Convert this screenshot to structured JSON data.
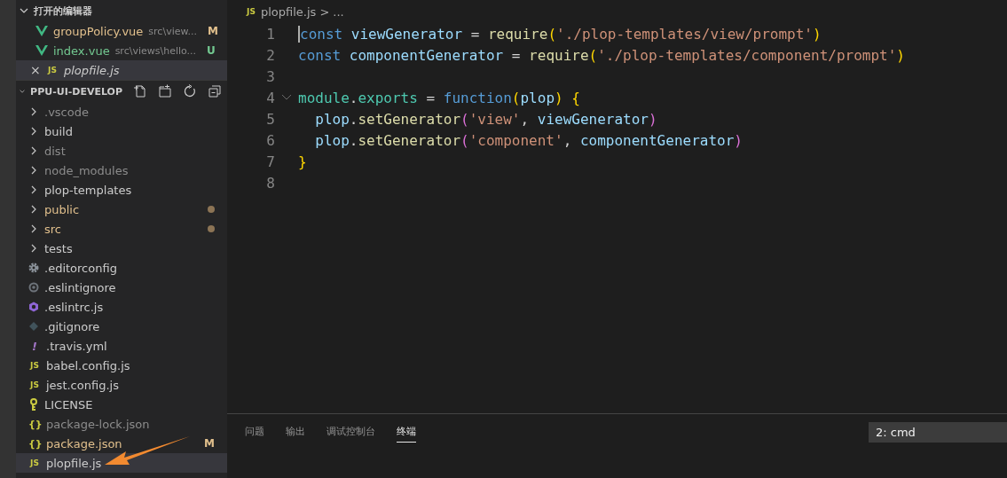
{
  "open_editors": {
    "title": "打开的编辑器",
    "expanded": true,
    "items": [
      {
        "kind": "vue",
        "name": "groupPolicy.vue",
        "path": "src\\view...",
        "color": "#e2c08d",
        "badge": "M",
        "selected": false
      },
      {
        "kind": "vue",
        "name": "index.vue",
        "path": "src\\views\\hello...",
        "color": "#73c991",
        "badge": "U",
        "selected": false
      },
      {
        "kind": "js",
        "icon_text": "JS",
        "name": "plopfile.js",
        "close": "×",
        "color": "#cccccc",
        "selected": true
      }
    ]
  },
  "explorer": {
    "title": "PPU-UI-DEVELOP",
    "expanded": true,
    "items": [
      {
        "kind": "folder",
        "name": ".vscode",
        "color": "#8c8c8c",
        "dot": false,
        "selected": false
      },
      {
        "kind": "folder",
        "name": "build",
        "color": "#cccccc",
        "dot": false,
        "selected": false
      },
      {
        "kind": "folder",
        "name": "dist",
        "color": "#8c8c8c",
        "dot": false,
        "selected": false
      },
      {
        "kind": "folder",
        "name": "node_modules",
        "color": "#8c8c8c",
        "dot": false,
        "selected": false
      },
      {
        "kind": "folder",
        "name": "plop-templates",
        "color": "#cccccc",
        "dot": false,
        "selected": false
      },
      {
        "kind": "folder",
        "name": "public",
        "color": "#e2c08d",
        "dot": true,
        "selected": false
      },
      {
        "kind": "folder",
        "name": "src",
        "color": "#e2c08d",
        "dot": true,
        "selected": false
      },
      {
        "kind": "folder",
        "name": "tests",
        "color": "#cccccc",
        "dot": false,
        "selected": false
      },
      {
        "kind": "gear",
        "name": ".editorconfig",
        "color": "#cccccc",
        "dot": false,
        "selected": false
      },
      {
        "kind": "circle",
        "name": ".eslintignore",
        "color": "#cccccc",
        "dot": false,
        "selected": false
      },
      {
        "kind": "eslint",
        "name": ".eslintrc.js",
        "color": "#cccccc",
        "dot": false,
        "selected": false
      },
      {
        "kind": "git",
        "name": ".gitignore",
        "color": "#cccccc",
        "dot": false,
        "selected": false
      },
      {
        "kind": "yml",
        "icon_text": "!",
        "name": ".travis.yml",
        "color": "#cccccc",
        "dot": false,
        "selected": false
      },
      {
        "kind": "js",
        "icon_text": "JS",
        "name": "babel.config.js",
        "color": "#cccccc",
        "dot": false,
        "selected": false
      },
      {
        "kind": "js",
        "icon_text": "JS",
        "name": "jest.config.js",
        "color": "#cccccc",
        "dot": false,
        "selected": false
      },
      {
        "kind": "license",
        "name": "LICENSE",
        "color": "#cccccc",
        "dot": false,
        "selected": false
      },
      {
        "kind": "json",
        "icon_text": "{}",
        "name": "package-lock.json",
        "color": "#8c8c8c",
        "dot": false,
        "selected": false
      },
      {
        "kind": "json",
        "icon_text": "{}",
        "name": "package.json",
        "color": "#e2c08d",
        "badge": "M",
        "dot": false,
        "selected": false
      },
      {
        "kind": "js",
        "icon_text": "JS",
        "name": "plopfile.js",
        "color": "#cccccc",
        "dot": false,
        "selected": true
      }
    ]
  },
  "breadcrumb": {
    "icon_text": "JS",
    "file": "plopfile.js",
    "separator": ">",
    "rest": "..."
  },
  "code": [
    {
      "number": "1",
      "tokens": [
        {
          "kind": "keyword",
          "text": "const"
        },
        {
          "kind": "variable",
          "text": " viewGenerator"
        },
        {
          "kind": "plain",
          "text": " = "
        },
        {
          "kind": "function",
          "text": "require"
        },
        {
          "kind": "paren",
          "text": "("
        },
        {
          "kind": "string",
          "text": "'./plop-templates/view/prompt'"
        },
        {
          "kind": "paren",
          "text": ")"
        }
      ]
    },
    {
      "number": "2",
      "tokens": [
        {
          "kind": "keyword",
          "text": "const"
        },
        {
          "kind": "variable",
          "text": " componentGenerator"
        },
        {
          "kind": "plain",
          "text": " = "
        },
        {
          "kind": "function",
          "text": "require"
        },
        {
          "kind": "paren",
          "text": "("
        },
        {
          "kind": "string",
          "text": "'./plop-templates/component/prompt'"
        },
        {
          "kind": "paren",
          "text": ")"
        }
      ]
    },
    {
      "number": "3"
    },
    {
      "number": "4",
      "fold": true,
      "tokens": [
        {
          "kind": "module",
          "text": "module"
        },
        {
          "kind": "plain",
          "text": "."
        },
        {
          "kind": "module",
          "text": "exports"
        },
        {
          "kind": "plain",
          "text": " = "
        },
        {
          "kind": "keyword",
          "text": "function"
        },
        {
          "kind": "paren",
          "text": "("
        },
        {
          "kind": "variable",
          "text": "plop"
        },
        {
          "kind": "paren",
          "text": ")"
        },
        {
          "kind": "paren",
          "text": " {"
        }
      ]
    },
    {
      "number": "5",
      "tokens": [
        {
          "kind": "variable",
          "text": "  plop"
        },
        {
          "kind": "plain",
          "text": "."
        },
        {
          "kind": "function",
          "text": "setGenerator"
        },
        {
          "kind": "paren2",
          "text": "("
        },
        {
          "kind": "string",
          "text": "'view'"
        },
        {
          "kind": "plain",
          "text": ","
        },
        {
          "kind": "variable",
          "text": " viewGenerator"
        },
        {
          "kind": "paren2",
          "text": ")"
        }
      ]
    },
    {
      "number": "6",
      "tokens": [
        {
          "kind": "variable",
          "text": "  plop"
        },
        {
          "kind": "plain",
          "text": "."
        },
        {
          "kind": "function",
          "text": "setGenerator"
        },
        {
          "kind": "paren2",
          "text": "("
        },
        {
          "kind": "string",
          "text": "'component'"
        },
        {
          "kind": "plain",
          "text": ","
        },
        {
          "kind": "variable",
          "text": " componentGenerator"
        },
        {
          "kind": "paren2",
          "text": ")"
        }
      ]
    },
    {
      "number": "7",
      "tokens": [
        {
          "kind": "paren",
          "text": "}"
        }
      ]
    },
    {
      "number": "8"
    }
  ],
  "panel": {
    "tabs": [
      {
        "label": "问题",
        "selected": false
      },
      {
        "label": "输出",
        "selected": false
      },
      {
        "label": "调试控制台",
        "selected": false
      },
      {
        "label": "终端",
        "selected": true
      }
    ],
    "terminal_select": "2: cmd"
  }
}
